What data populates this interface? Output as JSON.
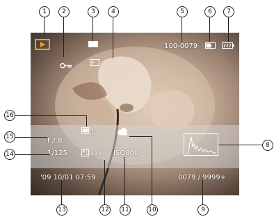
{
  "screen": {
    "file_number": "100-0079",
    "aperture": "F2.8",
    "shutter_speed": "1/125",
    "exposure_compensation": "+2.0",
    "iso": "ISO800",
    "datetime": "'09 10/01  07:59",
    "image_count": "0079 / 9999+",
    "image_size_label": "5M"
  },
  "callouts": [
    "1",
    "2",
    "3",
    "4",
    "5",
    "6",
    "7",
    "8",
    "9",
    "10",
    "11",
    "12",
    "13",
    "14",
    "15",
    "16"
  ],
  "colors": {
    "playback_icon": "#f0a020",
    "osd_text": "#ffffff",
    "callout_line": "#222222"
  },
  "icons": {
    "mode": "playback-icon",
    "protect": "key-icon",
    "voice": "voice-memo-icon",
    "dpof": "dpof-icon",
    "memory": "memory-card-icon",
    "battery": "battery-icon",
    "white_balance": "cloudy-wb-icon",
    "image_size": "image-size-icon",
    "exposure": "exposure-icon",
    "histogram": "histogram-icon"
  }
}
